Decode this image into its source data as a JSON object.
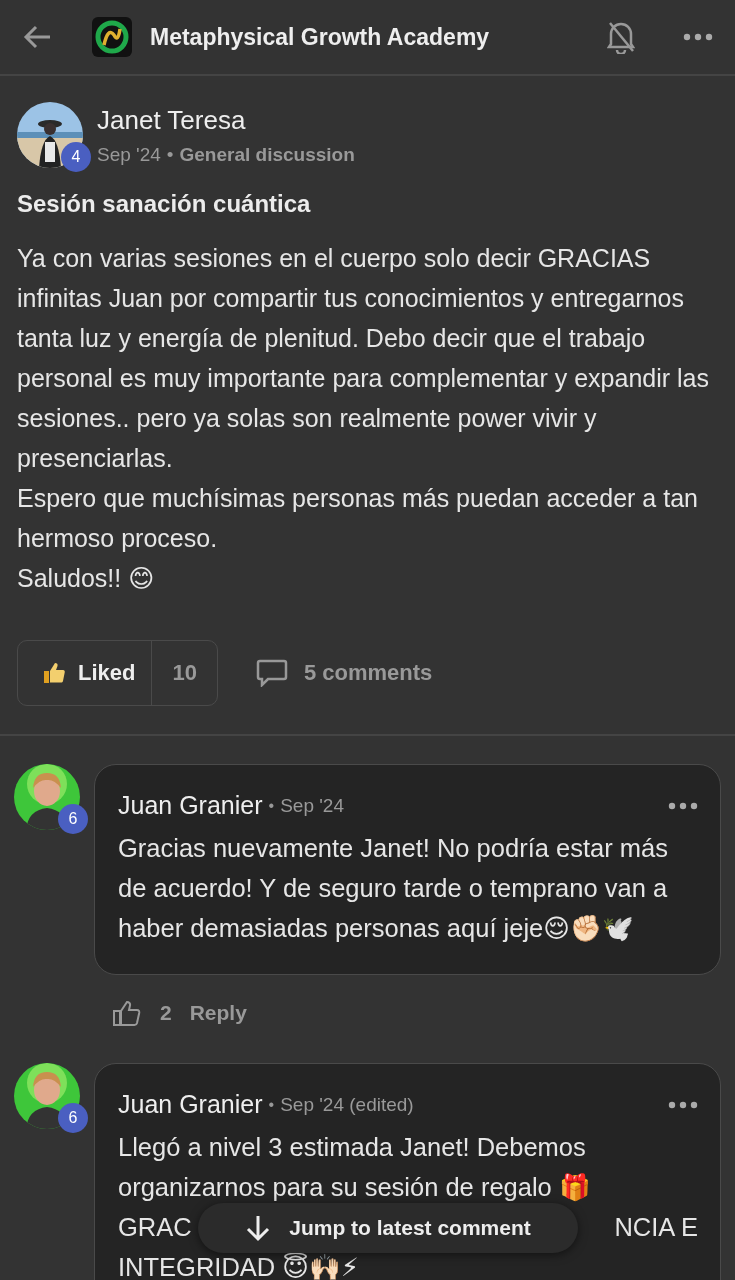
{
  "header": {
    "title": "Metaphysical Growth Academy",
    "notifications_muted": true
  },
  "post": {
    "author": "Janet Teresa",
    "level": "4",
    "date": "Sep '24",
    "separator": "•",
    "category": "General discussion",
    "title": "Sesión sanación cuántica",
    "body": [
      "Ya con varias sesiones en el cuerpo solo decir GRACIAS infinitas Juan por compartir tus conocimientos y entregarnos tanta luz y energía de plenitud. Debo decir que el trabajo personal es muy importante para complementar y expandir las sesiones.. pero ya solas son realmente power vivir y presenciarlas.",
      "Espero que muchísimas personas más puedan acceder a tan hermoso proceso.",
      "Saludos!! 😊"
    ],
    "like": {
      "label": "Liked",
      "liked": true,
      "count": "10"
    },
    "comments_label": "5 comments"
  },
  "comments": [
    {
      "author": "Juan Granier",
      "level": "6",
      "separator": "•",
      "date": "Sep '24",
      "lines": [
        [
          "Gracias nuevamente Janet! No podría estar más de acuerdo! Y de seguro tarde o temprano van a haber demasiadas personas aquí jeje😌✊🏻🕊️"
        ]
      ],
      "likes": "2",
      "reply": "Reply"
    },
    {
      "author": "Juan Granier",
      "level": "6",
      "separator": "•",
      "date": "Sep '24 (edited)",
      "lines": [
        [
          "Llegó a nivel 3 estimada Janet! Debemos"
        ],
        [
          "organizarnos para su sesión de regalo 🎁"
        ],
        [
          "GRAC",
          "NCIA E"
        ],
        [
          "INTEGRIDAD 😇🙌🏻⚡"
        ]
      ]
    }
  ],
  "jump_button": "Jump to latest comment"
}
